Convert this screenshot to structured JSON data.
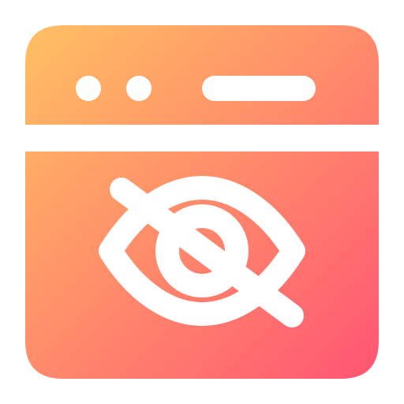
{
  "icon": {
    "name": "hidden-web-page",
    "depicts": [
      "browser-window",
      "eye-slash-icon"
    ],
    "colors": {
      "gradient_start": "#FFC062",
      "gradient_end": "#FF5573",
      "foreground": "#FFFFFF"
    }
  }
}
